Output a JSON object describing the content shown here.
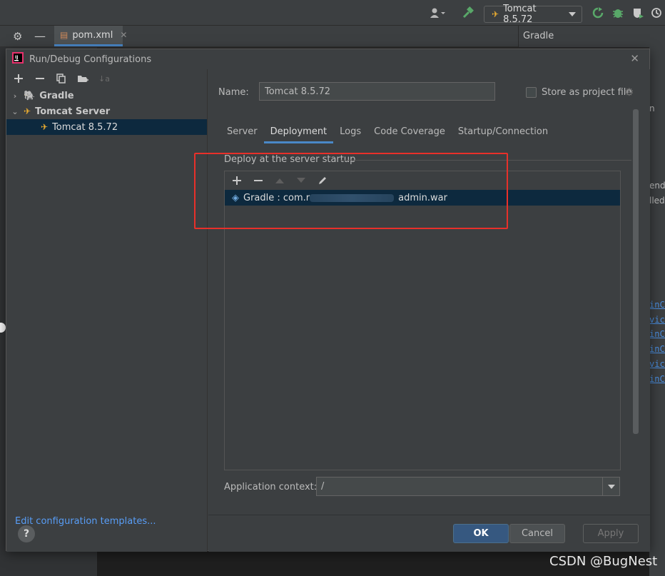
{
  "toolbar": {
    "run_config_label": "Tomcat 8.5.72",
    "icons": [
      "user-icon",
      "build-hammer-icon",
      "rerun-icon",
      "debug-bug-icon",
      "coverage-icon",
      "profile-icon"
    ]
  },
  "editor_tabs": [
    {
      "label": "pom.xml"
    }
  ],
  "side_panel": {
    "title": "Gradle",
    "text_fragments": [
      "n",
      "ende",
      "lled"
    ],
    "link_fragments": [
      "inCa",
      "vice",
      "inCa",
      "inCa",
      "vice",
      "inCa"
    ]
  },
  "dialog": {
    "title": "Run/Debug Configurations",
    "tree": [
      {
        "label": "Gradle",
        "bold": true,
        "expanded": false
      },
      {
        "label": "Tomcat Server",
        "bold": true,
        "expanded": true
      },
      {
        "label": "Tomcat 8.5.72",
        "bold": false,
        "selected": true
      }
    ],
    "edit_templates_link": "Edit configuration templates...",
    "name_label": "Name:",
    "name_value": "Tomcat 8.5.72",
    "store_as_project_file": "Store as project file",
    "store_checked": false,
    "tabs": [
      {
        "label": "Server",
        "active": false
      },
      {
        "label": "Deployment",
        "active": true
      },
      {
        "label": "Logs",
        "active": false
      },
      {
        "label": "Code Coverage",
        "active": false
      },
      {
        "label": "Startup/Connection",
        "active": false
      }
    ],
    "deployment": {
      "section_label": "Deploy at the server startup",
      "artifact_prefix": "Gradle : com.r",
      "artifact_suffix": "admin.war",
      "application_context_label": "Application context:",
      "application_context_value": "/"
    },
    "buttons": {
      "help": "?",
      "ok": "OK",
      "cancel": "Cancel",
      "apply": "Apply"
    }
  },
  "watermark": "CSDN @BugNest",
  "colors": {
    "accent": "#4a88c7",
    "selection": "#0d293e",
    "highlight": "#e8302a",
    "link": "#589df6"
  }
}
